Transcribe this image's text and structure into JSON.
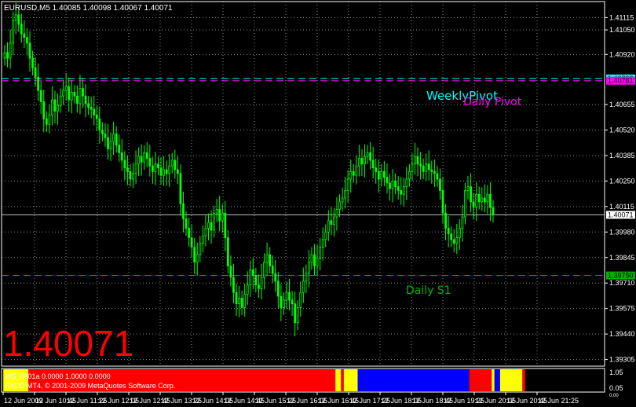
{
  "header": {
    "symbol_line": "EURUSD,M5  1.40085 1.40098 1.40067 1.40071"
  },
  "big_price": "1.40071",
  "lines": {
    "weekly_pivot": {
      "label": "WeeklyPivot",
      "price": "1.40793",
      "color": "#00ffff"
    },
    "daily_pivot": {
      "label": "Daily Pivot",
      "price": "1.40781",
      "color": "#ff00ff"
    },
    "daily_s1": {
      "label": "Daily S1",
      "price": "1.39750",
      "color": "#00b400"
    },
    "current": {
      "price": "1.40071",
      "color": "#c0c0c0"
    }
  },
  "y_axis_labels": [
    "1.41115",
    "1.41050",
    "1.40920",
    "1.40655",
    "1.40520",
    "1.40385",
    "1.40250",
    "1.40115",
    "1.39980",
    "1.39845",
    "1.39710",
    "1.39575",
    "1.39440",
    "1.39305"
  ],
  "x_axis_labels": [
    "12 Jun 2009",
    "12 Jun 10:45",
    "12 Jun 11:25",
    "12 Jun 12:05",
    "12 Jun 12:45",
    "12 Jun 13:25",
    "12 Jun 14:05",
    "12 Jun 14:45",
    "12 Jun 15:25",
    "12 Jun 16:05",
    "12 Jun 16:45",
    "12 Jun 17:25",
    "12 Jun 18:05",
    "12 Jun 18:45",
    "12 Jun 19:25",
    "12 Jun 20:05",
    "12 Jun 20:45",
    "12 Jun 21:25"
  ],
  "indicator": {
    "line1": "HG_0001a 0.0000 1.0000 0.0000",
    "line2": "FXDD MT4, © 2001-2009 MetaQuotes Software Corp.",
    "axis_labels": [
      "1.05",
      "0.05"
    ],
    "axis_small": "0.00",
    "segments": [
      {
        "color": "#ffff00",
        "from": 0,
        "to": 9
      },
      {
        "color": "#ff0000",
        "from": 9,
        "to": 119
      },
      {
        "color": "#ffff00",
        "from": 119,
        "to": 121
      },
      {
        "color": "#ff0000",
        "from": 121,
        "to": 122
      },
      {
        "color": "#ffff00",
        "from": 122,
        "to": 127
      },
      {
        "color": "#0000ff",
        "from": 127,
        "to": 167
      },
      {
        "color": "#ff0000",
        "from": 167,
        "to": 175
      },
      {
        "color": "#ffff00",
        "from": 175,
        "to": 176
      },
      {
        "color": "#0000ff",
        "from": 176,
        "to": 178
      },
      {
        "color": "#ffff00",
        "from": 178,
        "to": 186
      },
      {
        "color": "#ff0000",
        "from": 186,
        "to": 187
      }
    ]
  },
  "chart_data": {
    "type": "candlestick",
    "symbol": "EURUSD",
    "timeframe": "M5",
    "ylim": [
      1.3927,
      1.412
    ],
    "candle_color": "#00ff00",
    "closes": [
      1.4093,
      1.409,
      1.4098,
      1.411,
      1.4113,
      1.4108,
      1.4103,
      1.4101,
      1.4098,
      1.409,
      1.4085,
      1.408,
      1.4073,
      1.4067,
      1.4058,
      1.4055,
      1.406,
      1.4068,
      1.4062,
      1.4065,
      1.407,
      1.4073,
      1.4075,
      1.4068,
      1.4072,
      1.407,
      1.4066,
      1.4074,
      1.407,
      1.4066,
      1.4064,
      1.4063,
      1.406,
      1.4058,
      1.4052,
      1.405,
      1.4048,
      1.4042,
      1.4046,
      1.405,
      1.4044,
      1.404,
      1.4036,
      1.4032,
      1.403,
      1.4026,
      1.4029,
      1.4034,
      1.4038,
      1.4035,
      1.404,
      1.4037,
      1.4033,
      1.403,
      1.4034,
      1.4032,
      1.4028,
      1.4031,
      1.4029,
      1.4033,
      1.4036,
      1.4031,
      1.4029,
      1.4013,
      1.4005,
      1.4,
      1.3995,
      1.399,
      1.3982,
      1.3986,
      1.3992,
      1.3996,
      1.4,
      1.4003,
      1.3999,
      1.4008,
      1.401,
      1.4004,
      1.4008,
      1.3995,
      1.398,
      1.3974,
      1.3966,
      1.396,
      1.3963,
      1.3958,
      1.3965,
      1.397,
      1.3978,
      1.3975,
      1.397,
      1.3968,
      1.3974,
      1.3982,
      1.3986,
      1.398,
      1.3976,
      1.3972,
      1.3964,
      1.3958,
      1.3962,
      1.3966,
      1.3962,
      1.396,
      1.395,
      1.3958,
      1.3966,
      1.3972,
      1.3976,
      1.3982,
      1.3986,
      1.398,
      1.3984,
      1.399,
      1.3994,
      1.3998,
      1.4004,
      1.4002,
      1.4006,
      1.401,
      1.4014,
      1.4016,
      1.402,
      1.4026,
      1.403,
      1.4028,
      1.4033,
      1.4037,
      1.4034,
      1.4038,
      1.404,
      1.4036,
      1.4032,
      1.403,
      1.4026,
      1.403,
      1.4027,
      1.4024,
      1.4021,
      1.4025,
      1.4022,
      1.402,
      1.4018,
      1.4022,
      1.4026,
      1.403,
      1.4034,
      1.4038,
      1.4034,
      1.4033,
      1.403,
      1.4034,
      1.4031,
      1.403,
      1.4029,
      1.4026,
      1.402,
      1.4008,
      1.4,
      1.3997,
      1.3994,
      1.3992,
      1.3995,
      1.4,
      1.4006,
      1.402,
      1.4022,
      1.4014,
      1.4011,
      1.4018,
      1.4014,
      1.4016,
      1.4014,
      1.4018,
      1.4011,
      1.4007
    ]
  }
}
